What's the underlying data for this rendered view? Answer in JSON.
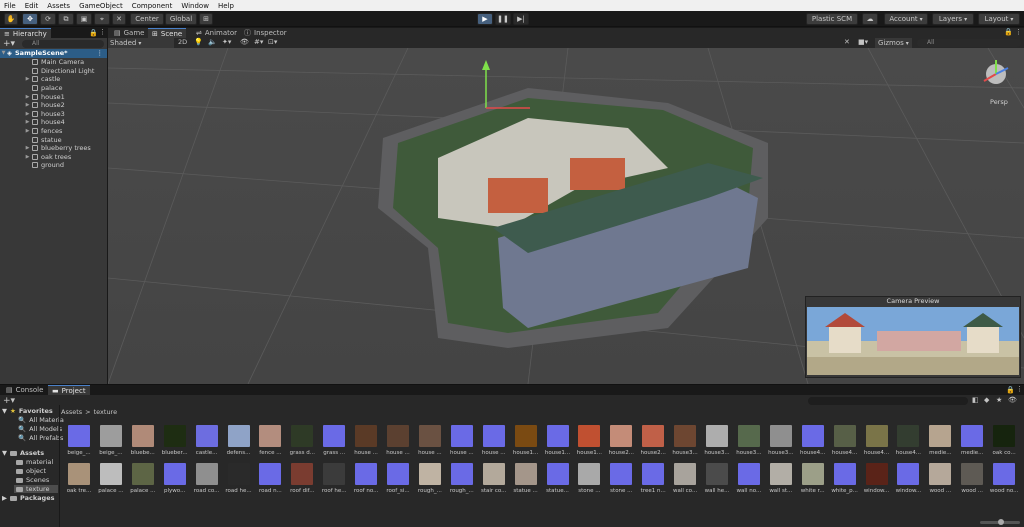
{
  "menu": [
    "File",
    "Edit",
    "Assets",
    "GameObject",
    "Component",
    "Window",
    "Help"
  ],
  "toolbar": {
    "pivot": "Center",
    "space": "Global",
    "plastic": "Plastic SCM",
    "account": "Account",
    "layers": "Layers",
    "layout": "Layout"
  },
  "hierarchy": {
    "tab": "Hierarchy",
    "search_placeholder": "All",
    "scene": "SampleScene*",
    "items": [
      {
        "label": "Main Camera",
        "expandable": false
      },
      {
        "label": "Directional Light",
        "expandable": false
      },
      {
        "label": "castle",
        "expandable": true
      },
      {
        "label": "palace",
        "expandable": false
      },
      {
        "label": "house1",
        "expandable": true
      },
      {
        "label": "house2",
        "expandable": true
      },
      {
        "label": "house3",
        "expandable": true
      },
      {
        "label": "house4",
        "expandable": true
      },
      {
        "label": "fences",
        "expandable": true
      },
      {
        "label": "statue",
        "expandable": false
      },
      {
        "label": "blueberry trees",
        "expandable": true
      },
      {
        "label": "oak trees",
        "expandable": true
      },
      {
        "label": "ground",
        "expandable": false
      }
    ]
  },
  "scene_tabs": [
    "Game",
    "Scene",
    "Animator",
    "Inspector"
  ],
  "scene_toolbar": {
    "draw_mode": "Shaded",
    "view_2d": "2D",
    "gizmos": "Gizmos",
    "search_placeholder": "All",
    "persp": "Persp"
  },
  "camera_preview": {
    "title": "Camera Preview"
  },
  "bottom_tabs": [
    "Console",
    "Project"
  ],
  "project": {
    "favorites_label": "Favorites",
    "favorites": [
      "All Materia",
      "All Models",
      "All Prefabs"
    ],
    "assets_label": "Assets",
    "folders": [
      "material",
      "object",
      "Scenes",
      "texture"
    ],
    "packages_label": "Packages",
    "breadcrumb_root": "Assets",
    "breadcrumb_sep": ">",
    "breadcrumb_current": "texture",
    "row1": [
      {
        "label": "beige_...",
        "color": "#6a6ae6"
      },
      {
        "label": "beige_...",
        "color": "#9d9d9d"
      },
      {
        "label": "bluebe...",
        "color": "#b08a78"
      },
      {
        "label": "blueber...",
        "color": "#1e2d12"
      },
      {
        "label": "castle...",
        "color": "#6d6de0"
      },
      {
        "label": "defens...",
        "color": "#8fa3c7"
      },
      {
        "label": "fence ...",
        "color": "#b38d7e"
      },
      {
        "label": "grass d...",
        "color": "#2e3a26"
      },
      {
        "label": "grass ...",
        "color": "#6a6ae6"
      },
      {
        "label": "house ...",
        "color": "#5a3a26"
      },
      {
        "label": "house ...",
        "color": "#5b4030"
      },
      {
        "label": "house ...",
        "color": "#6a5142"
      },
      {
        "label": "house ...",
        "color": "#6a6ae6"
      },
      {
        "label": "house ...",
        "color": "#6a6ae6"
      },
      {
        "label": "house1...",
        "color": "#7a4a12"
      },
      {
        "label": "house1...",
        "color": "#6a6ae6"
      },
      {
        "label": "house1...",
        "color": "#c05031"
      },
      {
        "label": "house2...",
        "color": "#c48c78"
      },
      {
        "label": "house2...",
        "color": "#c06048"
      },
      {
        "label": "house3...",
        "color": "#6d4631"
      },
      {
        "label": "house3...",
        "color": "#adadad"
      },
      {
        "label": "house3...",
        "color": "#56694c"
      },
      {
        "label": "house3...",
        "color": "#8f8f8f"
      },
      {
        "label": "house4...",
        "color": "#6a6ae6"
      },
      {
        "label": "house4...",
        "color": "#575f47"
      },
      {
        "label": "house4...",
        "color": "#7a7448"
      },
      {
        "label": "house4...",
        "color": "#333d30"
      },
      {
        "label": "medie...",
        "color": "#b6a48f"
      },
      {
        "label": "medie...",
        "color": "#6a6ae6"
      },
      {
        "label": "oak co...",
        "color": "#16240e"
      }
    ],
    "row2": [
      {
        "label": "oak tre...",
        "color": "#a99279"
      },
      {
        "label": "palace ...",
        "color": "#bdbdbd"
      },
      {
        "label": "palace ...",
        "color": "#5d6545"
      },
      {
        "label": "plywo...",
        "color": "#6a6ae6"
      },
      {
        "label": "road co...",
        "color": "#8f8f8f"
      },
      {
        "label": "road he...",
        "color": "#2a2a2a"
      },
      {
        "label": "road n...",
        "color": "#6a6ae6"
      },
      {
        "label": "roof dif...",
        "color": "#7a3c30"
      },
      {
        "label": "roof he...",
        "color": "#3b3b3b"
      },
      {
        "label": "roof no...",
        "color": "#6a6ae6"
      },
      {
        "label": "roof_si...",
        "color": "#6a6ae6"
      },
      {
        "label": "rough_...",
        "color": "#bfb3a3"
      },
      {
        "label": "rough_...",
        "color": "#6a6ae6"
      },
      {
        "label": "stair co...",
        "color": "#b3a99b"
      },
      {
        "label": "statue ...",
        "color": "#a4968a"
      },
      {
        "label": "statue...",
        "color": "#6a6ae6"
      },
      {
        "label": "stone ...",
        "color": "#a9a9a9"
      },
      {
        "label": "stone ...",
        "color": "#6a6ae6"
      },
      {
        "label": "tree1 n...",
        "color": "#6a6ae6"
      },
      {
        "label": "wall co...",
        "color": "#a8a39c"
      },
      {
        "label": "wall he...",
        "color": "#4b4b4b"
      },
      {
        "label": "wall no...",
        "color": "#6a6ae6"
      },
      {
        "label": "wall st...",
        "color": "#b2aea6"
      },
      {
        "label": "white r...",
        "color": "#9c9f88"
      },
      {
        "label": "white_p...",
        "color": "#6a6ae6"
      },
      {
        "label": "window...",
        "color": "#5a2318"
      },
      {
        "label": "window...",
        "color": "#6a6ae6"
      },
      {
        "label": "wood ...",
        "color": "#b5a89a"
      },
      {
        "label": "wood ...",
        "color": "#5e5a54"
      },
      {
        "label": "wood no...",
        "color": "#6a6ae6"
      }
    ]
  }
}
